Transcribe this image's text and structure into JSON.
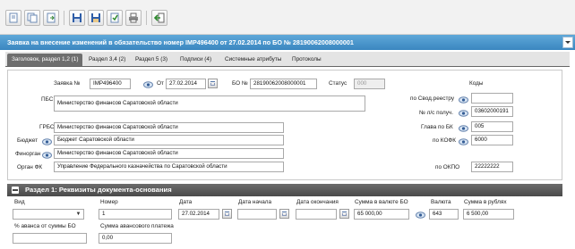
{
  "window": {
    "title": "Заявка на внесение изменений в обязательство номер IMP496400 от 27.02.2014 по БО № 28190062008000001"
  },
  "toolbar": {
    "buttons": [
      "new-doc-icon",
      "copy-doc-icon",
      "doc-export-icon",
      "save-icon",
      "save-as-icon",
      "save-check-icon",
      "print-icon",
      "exit-icon"
    ]
  },
  "tabs": [
    {
      "label": "Заголовок, раздел 1,2 (1)",
      "active": true
    },
    {
      "label": "Раздел 3,4 (2)",
      "active": false
    },
    {
      "label": "Раздел 5 (3)",
      "active": false
    },
    {
      "label": "Подписи (4)",
      "active": false
    },
    {
      "label": "Системные атрибуты",
      "active": false
    },
    {
      "label": "Протоколы",
      "active": false
    }
  ],
  "header": {
    "request_no_label": "Заявка №",
    "request_no": "IMP496400",
    "from_label": "От",
    "date": "27.02.2014",
    "bo_label": "БО №",
    "bo_no": "28190062008000001",
    "status_label": "Статус",
    "status": "000",
    "codes_label": "Коды",
    "pbs_label": "ПБС",
    "pbs": "Министерство финансов Саратовской области",
    "grbs_label": "ГРБС",
    "grbs": "Министерство финансов Саратовской области",
    "budget_label": "Бюджет",
    "budget": "Бюджет Саратовской области",
    "finorgan_label": "Финорган",
    "finorgan": "Министерство финансов Саратовской области",
    "organ_fk_label": "Орган ФК",
    "organ_fk": "Управление Федерального казначейства по Саратовской области",
    "svod_label": "по Свод.реестру",
    "svod": "",
    "ls_label": "№ л/с получ.",
    "ls": "03602000191",
    "glava_label": "Глава по БК",
    "glava": "005",
    "kofk_label": "по КОФК",
    "kofk": "6000",
    "okpo_label": "по ОКПО",
    "okpo": "22222222"
  },
  "section1": {
    "title": "Раздел 1: Реквизиты документа-основания",
    "vid_label": "Вид",
    "vid": "",
    "number_label": "Номер",
    "number": "1",
    "date_label": "Дата",
    "date": "27.02.2014",
    "start_label": "Дата начала",
    "start": "",
    "end_label": "Дата окончания",
    "end": "",
    "sum_bo_label": "Сумма в валюте БО",
    "sum_bo": "65 000,00",
    "currency_label": "Валюта",
    "currency": "643",
    "sum_rub_label": "Сумма в рублях",
    "sum_rub": "6 500,00",
    "advance_pct_label": "% аванса от суммы БО",
    "advance_pct": "",
    "advance_sum_label": "Сумма авансового платежа",
    "advance_sum": "0,00"
  }
}
